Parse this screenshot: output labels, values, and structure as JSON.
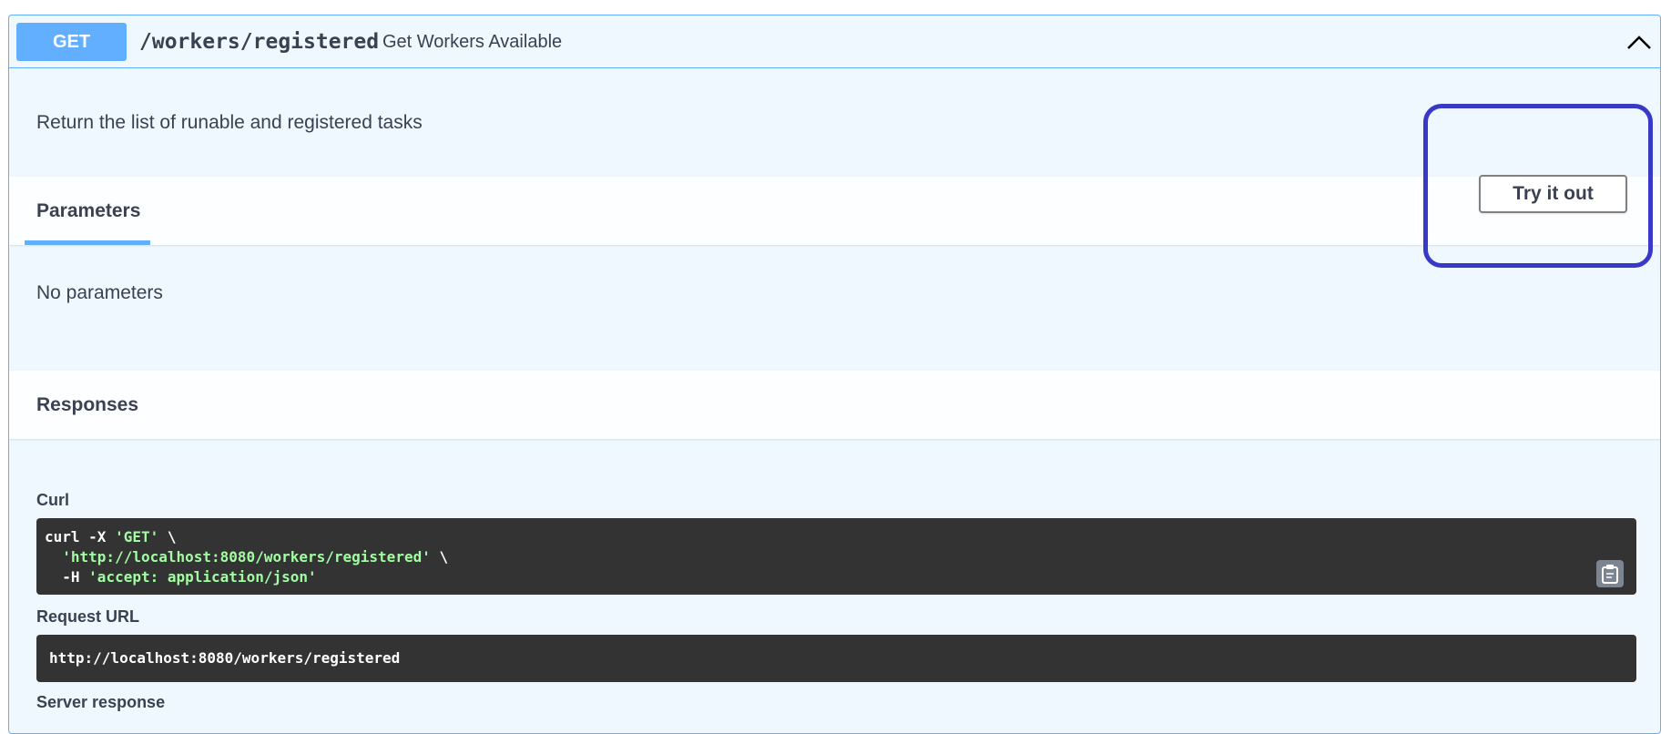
{
  "operation": {
    "method": "GET",
    "path": "/workers/registered",
    "summary": "Get Workers Available",
    "description": "Return the list of runable and registered tasks"
  },
  "parameters": {
    "title": "Parameters",
    "try_button": "Try it out",
    "empty_text": "No parameters"
  },
  "responses": {
    "title": "Responses",
    "curl_label": "Curl",
    "curl": {
      "line1_cmd": "curl -X ",
      "line1_method": "'GET'",
      "line1_end": " \\",
      "line2_indent": "  ",
      "line2_url": "'http://localhost:8080/workers/registered'",
      "line2_end": " \\",
      "line3_cmd": "  -H ",
      "line3_header": "'accept: application/json'"
    },
    "request_url_label": "Request URL",
    "request_url": "http://localhost:8080/workers/registered",
    "server_response_label": "Server response"
  },
  "colors": {
    "get_method": "#61affe",
    "code_background": "#333333",
    "code_string": "#a2fca2",
    "highlight": "#3939c8"
  },
  "icons": [
    "chevron-up-icon",
    "clipboard-icon"
  ]
}
